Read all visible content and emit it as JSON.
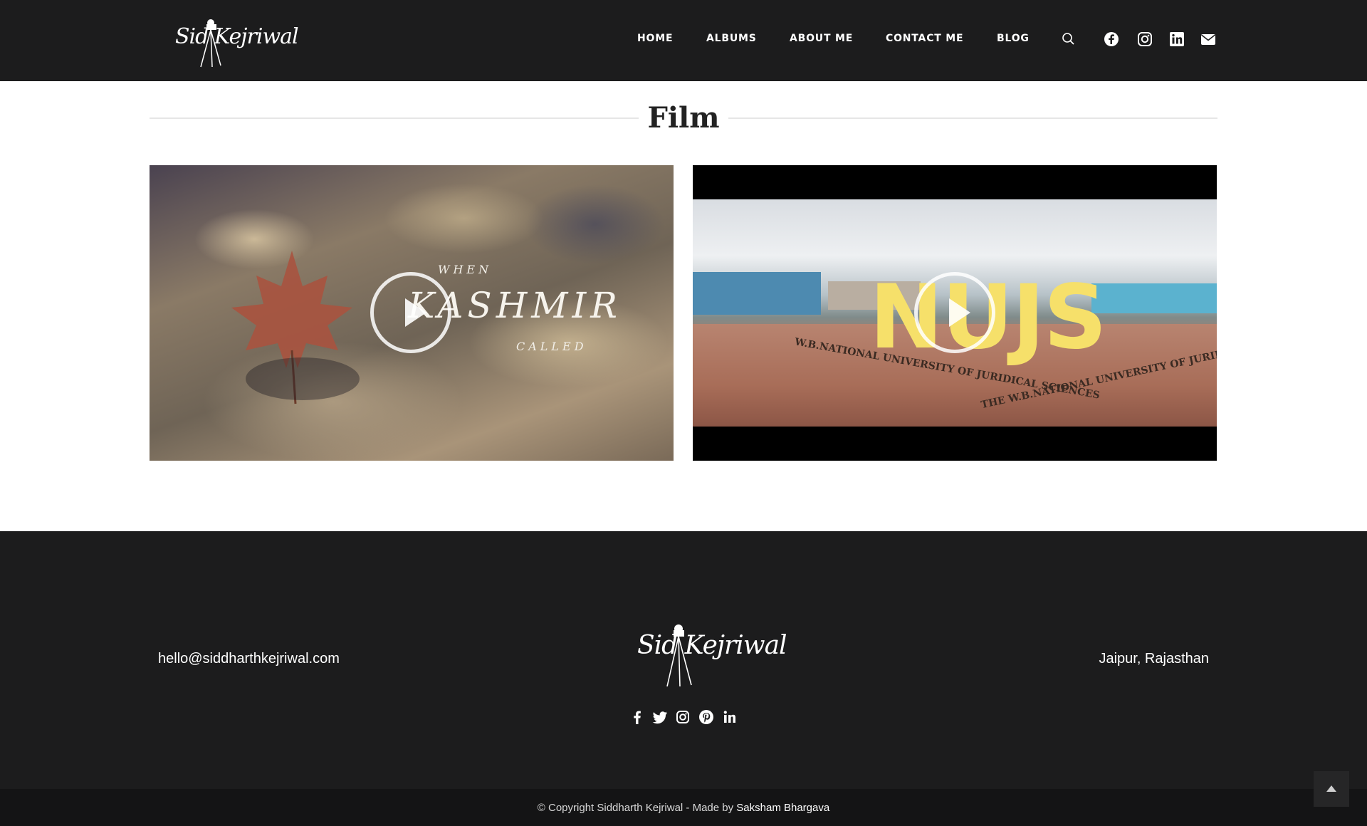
{
  "header": {
    "logo_text": "Sid Kejriwal",
    "nav": [
      "HOME",
      "ALBUMS",
      "ABOUT ME",
      "CONTACT ME",
      "BLOG"
    ],
    "icons": [
      "search-icon",
      "facebook-icon",
      "instagram-icon",
      "linkedin-icon",
      "envelope-icon"
    ]
  },
  "main": {
    "title": "Film",
    "videos": [
      {
        "overlay_top": "WHEN",
        "overlay_main": "KASHMIR",
        "overlay_bottom": "CALLED"
      },
      {
        "overlay_main": "NUJS",
        "facade_left": "W.B.NATIONAL UNIVERSITY OF JURIDICAL SCIENCES",
        "facade_right": "THE W.B.NATIONAL UNIVERSITY OF JURIDICAL SCIENCES"
      }
    ]
  },
  "footer": {
    "email": "hello@siddharthkejriwal.com",
    "location": "Jaipur, Rajasthan",
    "logo_text": "Sid Kejriwal",
    "social_icons": [
      "facebook-icon",
      "twitter-icon",
      "instagram-icon",
      "pinterest-icon",
      "linkedin-icon"
    ]
  },
  "copyright": {
    "text": "© Copyright Siddharth Kejriwal - Made by ",
    "author": "Saksham Bhargava"
  },
  "colors": {
    "dark": "#1c1c1d",
    "accent_yellow": "#f6e06a"
  }
}
